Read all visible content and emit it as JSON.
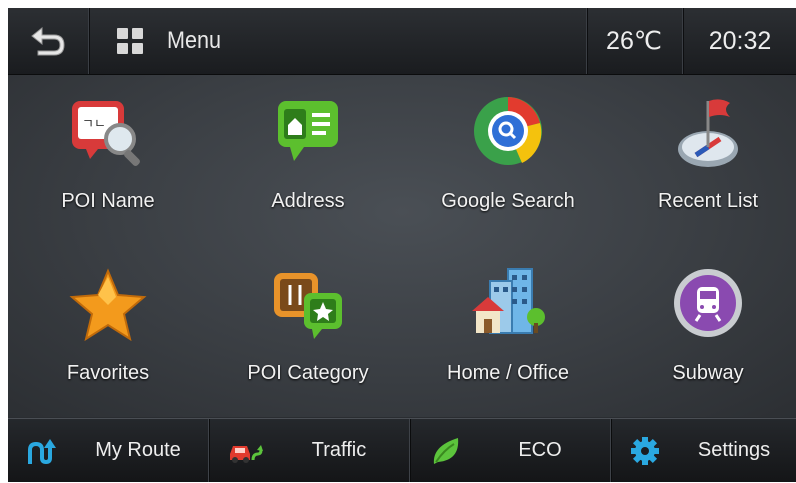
{
  "header": {
    "menu_label": "Menu",
    "temperature": "26℃",
    "time": "20:32"
  },
  "menu_items": [
    {
      "label": "POI Name",
      "icon": "poi-name-icon"
    },
    {
      "label": "Address",
      "icon": "address-icon"
    },
    {
      "label": "Google Search",
      "icon": "google-search-icon"
    },
    {
      "label": "Recent List",
      "icon": "recent-list-icon"
    },
    {
      "label": "Favorites",
      "icon": "favorites-star-icon"
    },
    {
      "label": "POI Category",
      "icon": "poi-category-icon"
    },
    {
      "label": "Home / Office",
      "icon": "home-office-icon"
    },
    {
      "label": "Subway",
      "icon": "subway-icon"
    }
  ],
  "bottom_bar": [
    {
      "label": "My Route",
      "icon": "my-route-icon"
    },
    {
      "label": "Traffic",
      "icon": "traffic-car-icon"
    },
    {
      "label": "ECO",
      "icon": "eco-leaf-icon"
    },
    {
      "label": "Settings",
      "icon": "settings-gear-icon"
    }
  ],
  "colors": {
    "background": "#2a2d31",
    "text": "#f2f2f2",
    "accent_blue": "#2aa8e0",
    "accent_green": "#5cc43c"
  }
}
